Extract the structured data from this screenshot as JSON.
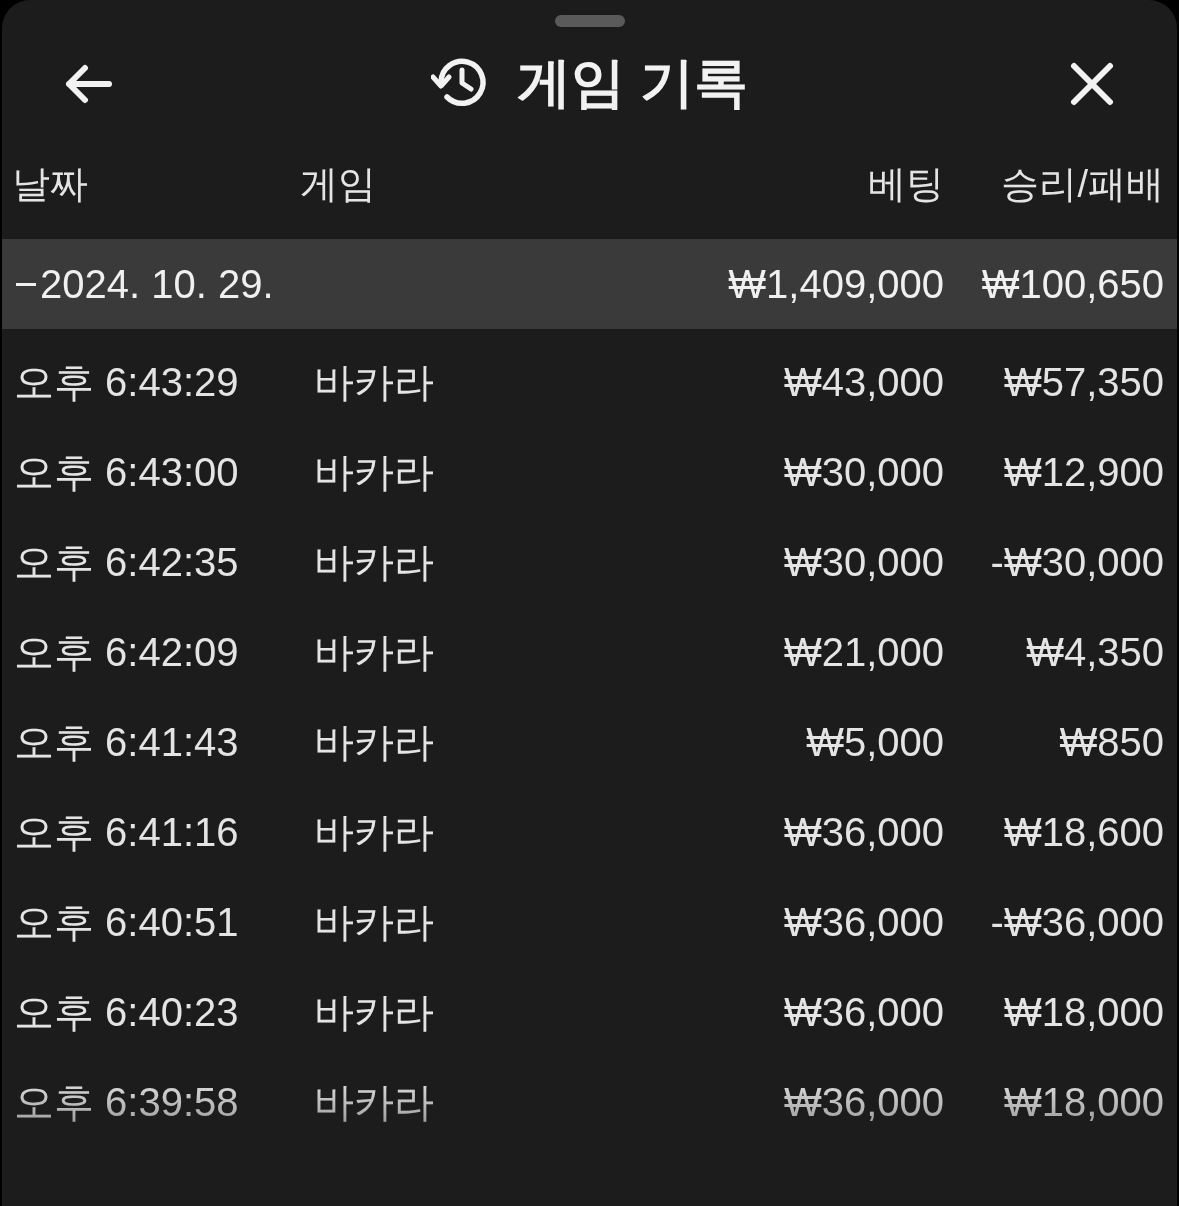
{
  "header": {
    "title": "게임 기록"
  },
  "table": {
    "columns": [
      "날짜",
      "게임",
      "베팅",
      "승리/패배"
    ],
    "group": {
      "date": "2024. 10. 29.",
      "expanded": true,
      "bet": "₩1,409,000",
      "result": "₩100,650"
    },
    "rows": [
      {
        "time": "오후 6:43:29",
        "game": "바카라",
        "bet": "₩43,000",
        "result": "₩57,350"
      },
      {
        "time": "오후 6:43:00",
        "game": "바카라",
        "bet": "₩30,000",
        "result": "₩12,900"
      },
      {
        "time": "오후 6:42:35",
        "game": "바카라",
        "bet": "₩30,000",
        "result": "-₩30,000"
      },
      {
        "time": "오후 6:42:09",
        "game": "바카라",
        "bet": "₩21,000",
        "result": "₩4,350"
      },
      {
        "time": "오후 6:41:43",
        "game": "바카라",
        "bet": "₩5,000",
        "result": "₩850"
      },
      {
        "time": "오후 6:41:16",
        "game": "바카라",
        "bet": "₩36,000",
        "result": "₩18,600"
      },
      {
        "time": "오후 6:40:51",
        "game": "바카라",
        "bet": "₩36,000",
        "result": "-₩36,000"
      },
      {
        "time": "오후 6:40:23",
        "game": "바카라",
        "bet": "₩36,000",
        "result": "₩18,000"
      },
      {
        "time": "오후 6:39:58",
        "game": "바카라",
        "bet": "₩36,000",
        "result": "₩18,000"
      }
    ]
  }
}
